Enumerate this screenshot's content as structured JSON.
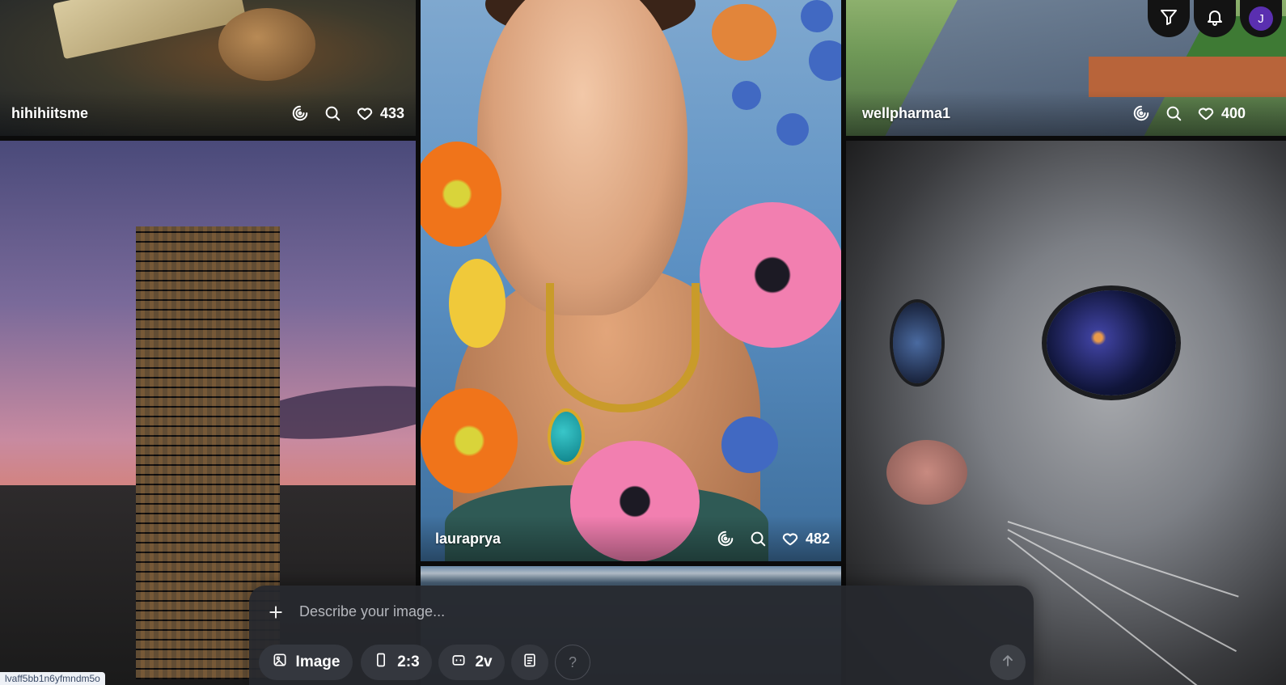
{
  "tiles": [
    {
      "id": "painting",
      "username": "hihihiitsme",
      "likes": "433"
    },
    {
      "id": "tower",
      "username": "",
      "likes": ""
    },
    {
      "id": "portrait",
      "username": "lauraprya",
      "likes": "482"
    },
    {
      "id": "street",
      "username": "wellpharma1",
      "likes": "400"
    },
    {
      "id": "cat",
      "username": "",
      "likes": ""
    }
  ],
  "header": {
    "avatar_initial": "J"
  },
  "composer": {
    "placeholder": "Describe your image...",
    "mode_label": "Image",
    "aspect_label": "2:3",
    "version_label": "2v",
    "help_label": "?"
  },
  "status_url": "lvaff5bb1n6yfmndm5o",
  "icons": [
    "remix-icon",
    "search-icon",
    "heart-icon",
    "filter-icon",
    "bell-icon",
    "plus-icon",
    "image-icon",
    "portrait-ratio-icon",
    "robot-icon",
    "clipboard-icon",
    "arrow-up-icon"
  ],
  "colors": {
    "avatar_bg": "#5a2fb0",
    "composer_bg": "#26282e",
    "pill_bg": "#34373e"
  }
}
